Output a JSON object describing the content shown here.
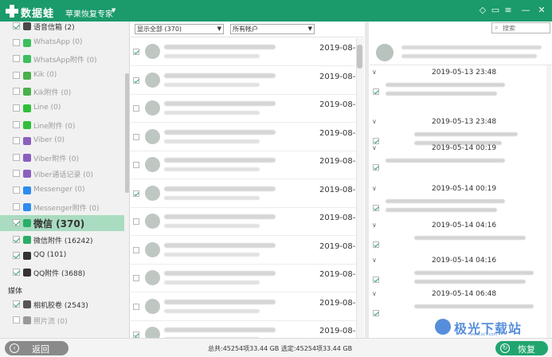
{
  "app": {
    "title": "数据蛙",
    "product": "苹果恢复专家",
    "accent": "#1b9a6b"
  },
  "titlebar_icons": [
    "diamond-icon",
    "chat-bubble-icon",
    "menu-icon",
    "minimize-icon",
    "close-icon"
  ],
  "sidebar": {
    "items": [
      {
        "label": "语音信箱 (2)",
        "checked": true,
        "dim": false,
        "icon": "voicemail-icon",
        "icon_color": "#4a4a4a"
      },
      {
        "label": "WhatsApp (0)",
        "checked": false,
        "dim": true,
        "icon": "whatsapp-icon",
        "icon_color": "#3cbf5c"
      },
      {
        "label": "WhatsApp附件 (0)",
        "checked": false,
        "dim": true,
        "icon": "whatsapp-attachment-icon",
        "icon_color": "#3cbf5c"
      },
      {
        "label": "Kik (0)",
        "checked": false,
        "dim": true,
        "icon": "kik-icon",
        "icon_color": "#49b04a"
      },
      {
        "label": "Kik附件 (0)",
        "checked": false,
        "dim": true,
        "icon": "kik-attachment-icon",
        "icon_color": "#49b04a"
      },
      {
        "label": "Line (0)",
        "checked": false,
        "dim": true,
        "icon": "line-icon",
        "icon_color": "#2fbf3a"
      },
      {
        "label": "Line附件 (0)",
        "checked": false,
        "dim": true,
        "icon": "line-attachment-icon",
        "icon_color": "#2fbf3a"
      },
      {
        "label": "Viber (0)",
        "checked": false,
        "dim": true,
        "icon": "viber-icon",
        "icon_color": "#8a5fbf"
      },
      {
        "label": "Viber附件 (0)",
        "checked": false,
        "dim": true,
        "icon": "viber-attachment-icon",
        "icon_color": "#8a5fbf"
      },
      {
        "label": "Viber通话记录 (0)",
        "checked": false,
        "dim": true,
        "icon": "viber-calls-icon",
        "icon_color": "#8a5fbf"
      },
      {
        "label": "Messenger (0)",
        "checked": false,
        "dim": true,
        "icon": "messenger-icon",
        "icon_color": "#2d8cf0"
      },
      {
        "label": "Messenger附件 (0)",
        "checked": false,
        "dim": true,
        "icon": "messenger-attachment-icon",
        "icon_color": "#2d8cf0"
      },
      {
        "label": "微信 (370)",
        "checked": true,
        "dim": false,
        "selected": true,
        "icon": "wechat-icon",
        "icon_color": "#2aae67"
      },
      {
        "label": "微信附件 (16242)",
        "checked": true,
        "dim": false,
        "icon": "wechat-attachment-icon",
        "icon_color": "#2aae67"
      },
      {
        "label": "QQ (101)",
        "checked": true,
        "dim": false,
        "icon": "qq-icon",
        "icon_color": "#333333"
      },
      {
        "label": "QQ附件 (3688)",
        "checked": true,
        "dim": false,
        "icon": "qq-attachment-icon",
        "icon_color": "#333333"
      }
    ],
    "section_media": "媒体",
    "media_items": [
      {
        "label": "相机胶卷 (2543)",
        "checked": true,
        "dim": false,
        "icon": "camera-roll-icon",
        "icon_color": "#555555"
      },
      {
        "label": "照片流 (0)",
        "checked": false,
        "dim": true,
        "icon": "photo-stream-icon",
        "icon_color": "#999999"
      }
    ]
  },
  "filters": {
    "show": "显示全部 (370)",
    "account": "所有帐户"
  },
  "messages": {
    "dates": [
      "2019-08-2",
      "2019-08-2",
      "2019-08-2",
      "2019-08-2",
      "2019-08-2",
      "2019-08-2",
      "2019-08-2",
      "2019-08-2",
      "2019-08-2",
      "2019-08-2",
      "2019-08-2"
    ],
    "checked": [
      true,
      true,
      false,
      false,
      false,
      true,
      false,
      false,
      false,
      false,
      true
    ]
  },
  "search": {
    "placeholder": "搜索"
  },
  "chat": {
    "times": [
      "2019-05-13 23:48",
      "2019-05-13 23:48",
      "2019-05-14 00:19",
      "2019-05-14 00:19",
      "2019-05-14 04:16",
      "2019-05-14 04:16",
      "2019-05-14 06:48"
    ]
  },
  "status": {
    "total": "总共:45254项33.44 GB 选定:45254项33.44 GB"
  },
  "buttons": {
    "back": "返回",
    "recover": "恢复"
  },
  "watermark": {
    "text": "极光下载站",
    "url": "www.xz7.com"
  }
}
